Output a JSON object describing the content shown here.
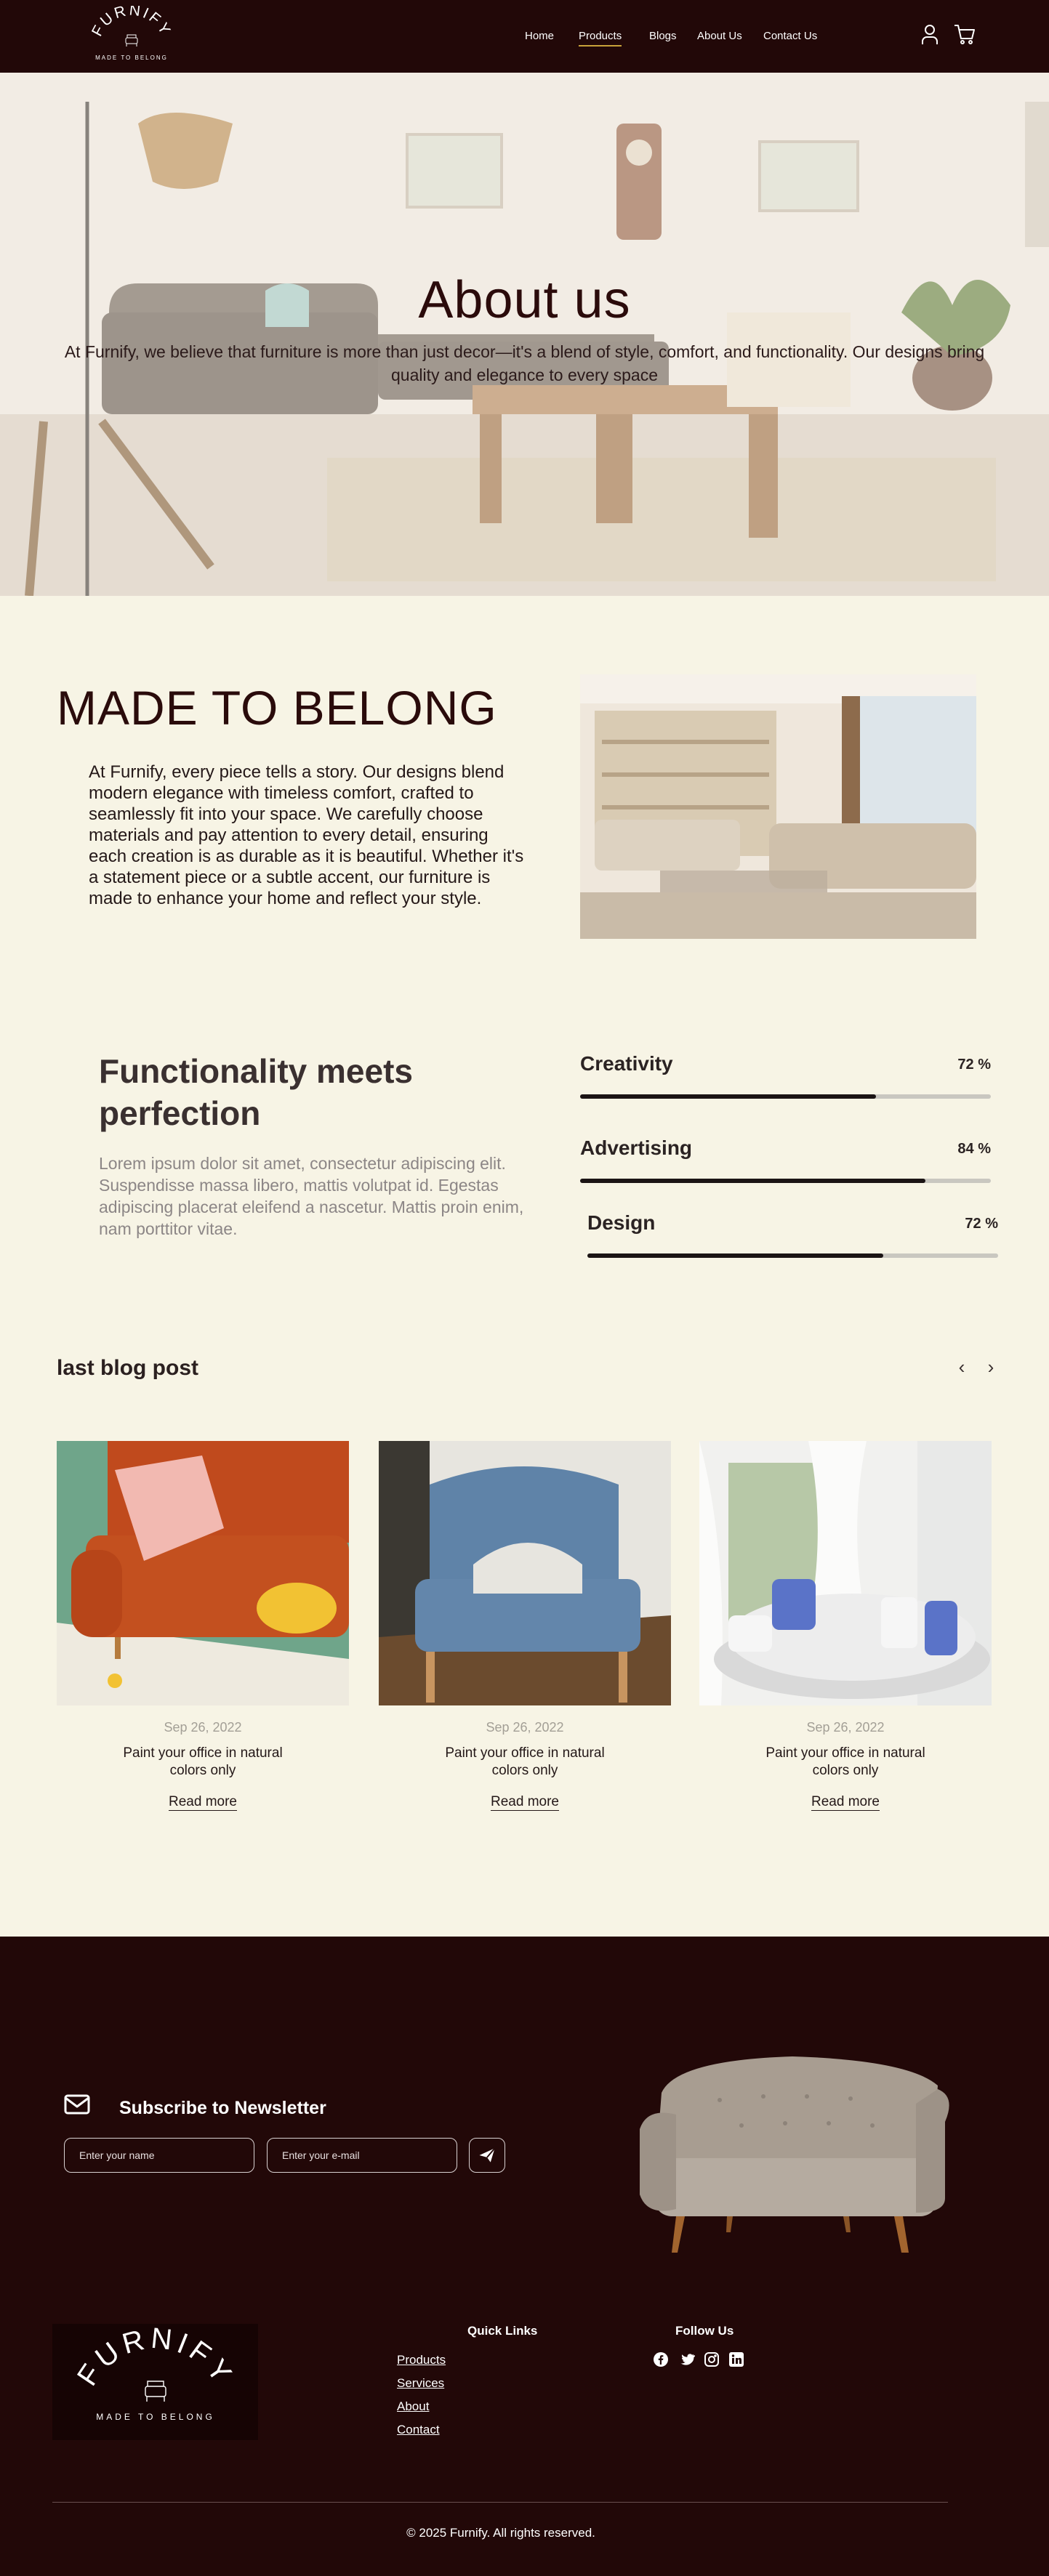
{
  "brand": {
    "name": "FURNIFY",
    "tagline": "MADE TO BELONG"
  },
  "nav": {
    "items": [
      "Home",
      "Products",
      "Blogs",
      "About Us",
      "Contact Us"
    ],
    "active": "Products"
  },
  "header_icons": [
    "user-icon",
    "cart-icon"
  ],
  "hero": {
    "title": "About us",
    "text": "At Furnify, we believe that furniture is more than just decor—it's a blend of style, comfort, and functionality. Our designs bring quality and elegance to every space"
  },
  "made_to_belong": {
    "title": "MADE TO BELONG",
    "text": "At Furnify, every piece tells a story. Our designs blend modern elegance with timeless comfort, crafted to seamlessly fit into your space. We carefully choose materials and pay attention to every detail, ensuring each creation is as durable as it is beautiful. Whether it's a statement piece or a subtle accent, our furniture is made to enhance your home and reflect your style."
  },
  "functionality": {
    "title": "Functionality meets perfection",
    "text": "Lorem ipsum dolor sit amet, consectetur adipiscing elit. Suspendisse massa libero, mattis volutpat id. Egestas adipiscing placerat eleifend a nascetur. Mattis proin enim, nam porttitor vitae.",
    "skills": [
      {
        "name": "Creativity",
        "value_label": "72 %",
        "value": 72
      },
      {
        "name": "Advertising",
        "value_label": "84 %",
        "value": 84
      },
      {
        "name": "Design",
        "value_label": "72 %",
        "value": 72
      }
    ]
  },
  "blog": {
    "title": "last blog post",
    "prev_icon": "chevron-left-icon",
    "next_icon": "chevron-right-icon",
    "posts": [
      {
        "date": "Sep 26, 2022",
        "title": "Paint your office in natural colors only",
        "link": "Read more"
      },
      {
        "date": "Sep 26, 2022",
        "title": "Paint your office in natural colors only",
        "link": "Read more"
      },
      {
        "date": "Sep 26, 2022",
        "title": "Paint your office in natural colors only",
        "link": "Read more"
      }
    ]
  },
  "newsletter": {
    "title": "Subscribe to Newsletter",
    "name_placeholder": "Enter your name",
    "email_placeholder": "Enter your e-mail"
  },
  "footer": {
    "quick_links_title": "Quick Links",
    "quick_links": [
      "Products",
      "Services",
      "About",
      "Contact"
    ],
    "follow_title": "Follow Us",
    "social": [
      "facebook-icon",
      "twitter-icon",
      "instagram-icon",
      "linkedin-icon"
    ],
    "copyright": "© 2025 Furnify. All rights reserved."
  },
  "colors": {
    "dark_maroon": "#220808",
    "cream": "#f7f4e5",
    "accent_gold": "#c8a23a"
  }
}
